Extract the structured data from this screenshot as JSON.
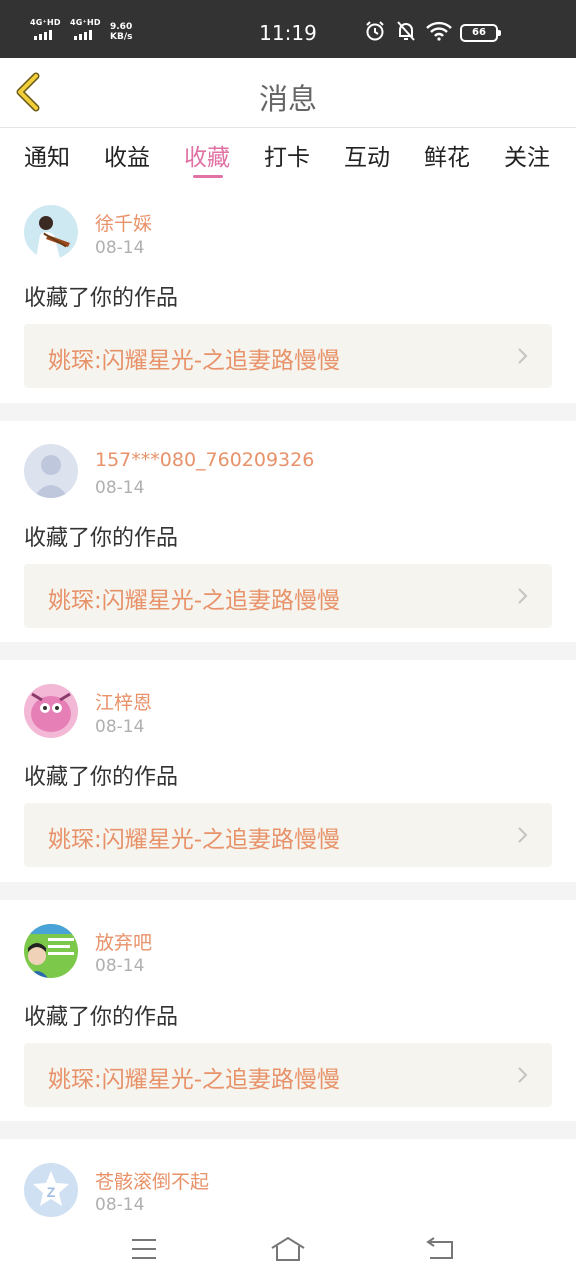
{
  "status_bar": {
    "signal1": "4G⁺HD",
    "signal2": "4G⁺HD",
    "speed_value": "9.60",
    "speed_unit": "KB/s",
    "time": "11:19",
    "battery": "66"
  },
  "header": {
    "title": "消息",
    "back_icon": "chevron-left-icon"
  },
  "tabs": [
    {
      "label": "通知",
      "active": false
    },
    {
      "label": "收益",
      "active": false
    },
    {
      "label": "收藏",
      "active": true
    },
    {
      "label": "打卡",
      "active": false
    },
    {
      "label": "互动",
      "active": false
    },
    {
      "label": "鲜花",
      "active": false
    },
    {
      "label": "关注",
      "active": false
    }
  ],
  "notifications": [
    {
      "user": "徐千婇",
      "date": "08-14",
      "action": "收藏了你的作品",
      "work": "姚琛:闪耀星光-之追妻路慢慢"
    },
    {
      "user": "157***080_760209326",
      "date": "08-14",
      "action": "收藏了你的作品",
      "work": "姚琛:闪耀星光-之追妻路慢慢"
    },
    {
      "user": "江梓恩",
      "date": "08-14",
      "action": "收藏了你的作品",
      "work": "姚琛:闪耀星光-之追妻路慢慢"
    },
    {
      "user": "放弃吧",
      "date": "08-14",
      "action": "收藏了你的作品",
      "work": "姚琛:闪耀星光-之追妻路慢慢"
    },
    {
      "user": "苍骸滚倒不起",
      "date": "08-14"
    }
  ],
  "colors": {
    "accent": "#e072a4",
    "name": "#e8926a",
    "status_bar": "#333333",
    "work_bg": "#f5f4ee"
  },
  "nav": {
    "menu_icon": "menu-icon",
    "home_icon": "home-icon",
    "back_icon": "back-icon"
  }
}
